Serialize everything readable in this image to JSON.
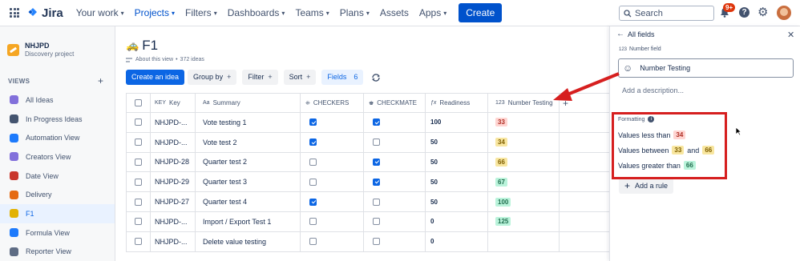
{
  "topnav": {
    "logo": "Jira",
    "items": [
      {
        "label": "Your work",
        "active": false
      },
      {
        "label": "Projects",
        "active": true
      },
      {
        "label": "Filters",
        "active": false
      },
      {
        "label": "Dashboards",
        "active": false
      },
      {
        "label": "Teams",
        "active": false
      },
      {
        "label": "Plans",
        "active": false
      },
      {
        "label": "Assets",
        "active": false,
        "no_caret": true
      },
      {
        "label": "Apps",
        "active": false
      }
    ],
    "create": "Create",
    "search_placeholder": "Search",
    "notifications_badge": "9+"
  },
  "sidebar": {
    "project_name": "NHJPD",
    "project_type": "Discovery project",
    "views_heading": "VIEWS",
    "views": [
      {
        "label": "All Ideas",
        "color": "#8270db"
      },
      {
        "label": "In Progress Ideas",
        "color": "#44546f"
      },
      {
        "label": "Automation View",
        "color": "#1d7afc"
      },
      {
        "label": "Creators View",
        "color": "#8270db"
      },
      {
        "label": "Date View",
        "color": "#c9372c"
      },
      {
        "label": "Delivery",
        "color": "#e56910"
      },
      {
        "label": "F1",
        "color": "#e2b203",
        "selected": true
      },
      {
        "label": "Formula View",
        "color": "#1d7afc"
      },
      {
        "label": "Reporter View",
        "color": "#5e6c84"
      }
    ]
  },
  "main": {
    "title": "F1",
    "about": "About this view",
    "ideas_count": "372 ideas",
    "toolbar": {
      "create_idea": "Create an idea",
      "group_by": "Group by",
      "filter": "Filter",
      "sort": "Sort",
      "fields": "Fields",
      "fields_count": "6"
    },
    "columns": {
      "key": "Key",
      "summary": "Summary",
      "checkers": "CHECKERS",
      "checkmate": "CHECKMATE",
      "readiness": "Readiness",
      "number_testing": "Number Testing"
    },
    "rows": [
      {
        "key": "NHJPD-...",
        "summary": "Vote testing 1",
        "checkers": true,
        "checkmate": true,
        "readiness": "100",
        "number": "33",
        "numcolor": "red"
      },
      {
        "key": "NHJPD-...",
        "summary": "Vote test 2",
        "checkers": true,
        "checkmate": false,
        "readiness": "50",
        "number": "34",
        "numcolor": "yellow"
      },
      {
        "key": "NHJPD-28",
        "summary": "Quarter test 2",
        "checkers": false,
        "checkmate": true,
        "readiness": "50",
        "number": "66",
        "numcolor": "yellow"
      },
      {
        "key": "NHJPD-29",
        "summary": "Quarter test 3",
        "checkers": false,
        "checkmate": true,
        "readiness": "50",
        "number": "67",
        "numcolor": "green"
      },
      {
        "key": "NHJPD-27",
        "summary": "Quarter test 4",
        "checkers": true,
        "checkmate": false,
        "readiness": "50",
        "number": "100",
        "numcolor": "green"
      },
      {
        "key": "NHJPD-...",
        "summary": "Import / Export Test 1",
        "checkers": false,
        "checkmate": false,
        "readiness": "0",
        "number": "125",
        "numcolor": "green"
      },
      {
        "key": "NHJPD-...",
        "summary": "Delete value testing",
        "checkers": false,
        "checkmate": false,
        "readiness": "0",
        "number": "",
        "numcolor": ""
      }
    ]
  },
  "panel": {
    "back_label": "All fields",
    "field_type": "Number field",
    "field_name": "Number Testing",
    "description_placeholder": "Add a description...",
    "formatting_label": "Formatting",
    "rules": {
      "less_label": "Values less than",
      "less_value": "34",
      "between_label": "Values between",
      "between_low": "33",
      "between_and": "and",
      "between_high": "66",
      "greater_label": "Values greater than",
      "greater_value": "66"
    },
    "add_rule": "Add a rule"
  },
  "colors": {
    "red": {
      "bg": "#ffd5d2",
      "fg": "#ae2e24"
    },
    "yellow": {
      "bg": "#f8e6a0",
      "fg": "#7f5f01"
    },
    "green": {
      "bg": "#baf3db",
      "fg": "#216e4e"
    },
    "annotation": "#d61f1f"
  }
}
